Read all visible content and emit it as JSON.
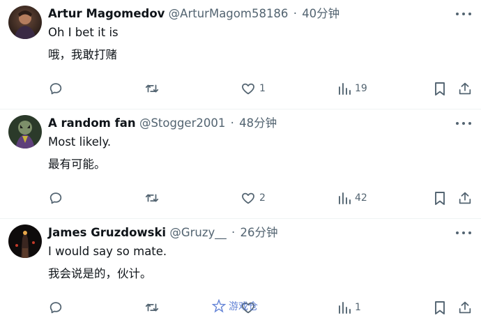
{
  "tweets": [
    {
      "name": "Artur Magomedov",
      "handle": "@ArturMagom58186",
      "dot": "·",
      "time": "40分钟",
      "text_en": "Oh I bet it is",
      "text_cn": "哦，我敢打赌",
      "likes": "1",
      "views": "19"
    },
    {
      "name": "A random fan",
      "handle": "@Stogger2001",
      "dot": "·",
      "time": "48分钟",
      "text_en": "Most likely.",
      "text_cn": "最有可能。",
      "likes": "2",
      "views": "42"
    },
    {
      "name": "James Gruzdowski",
      "handle": "@Gruzy__",
      "dot": "·",
      "time": "26分钟",
      "text_en": "I would say so mate.",
      "text_cn": "我会说是的，伙计。",
      "likes": "",
      "views": "1"
    }
  ],
  "icons": {
    "reply": "reply-icon",
    "retweet": "retweet-icon",
    "like": "heart-icon",
    "views": "views-icon",
    "bookmark": "bookmark-icon",
    "share": "share-icon",
    "more": "more-icon"
  },
  "watermark": {
    "text": "游戏仓"
  },
  "colors": {
    "text": "#0f1419",
    "secondary": "#536471",
    "divider": "#eff3f4",
    "watermark": "#4a6fd0"
  }
}
